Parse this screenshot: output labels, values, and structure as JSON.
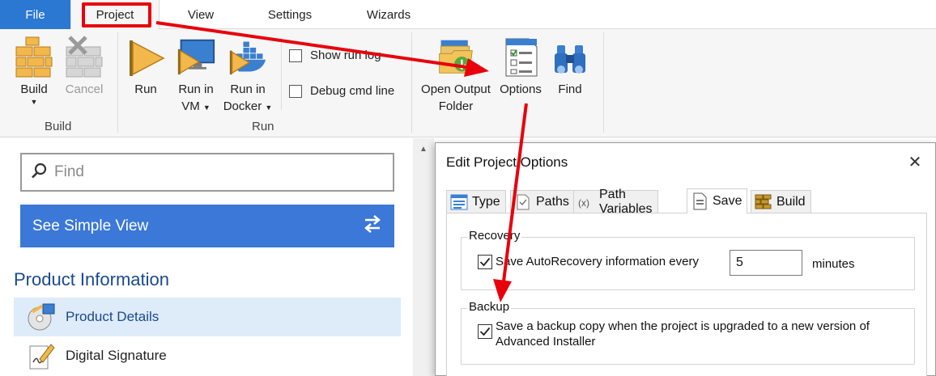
{
  "tabs": {
    "file": "File",
    "project": "Project",
    "view": "View",
    "settings": "Settings",
    "wizards": "Wizards"
  },
  "ribbon": {
    "build_group": {
      "label": "Build",
      "build": "Build",
      "cancel": "Cancel"
    },
    "run_group": {
      "label": "Run",
      "run": "Run",
      "run_in_vm_1": "Run in",
      "run_in_vm_2": "VM",
      "run_in_docker_1": "Run in",
      "run_in_docker_2": "Docker",
      "show_run_log": "Show run log",
      "debug_cmd_line": "Debug cmd line"
    },
    "tools_group": {
      "open_output_1": "Open Output",
      "open_output_2": "Folder",
      "options": "Options",
      "find": "Find"
    }
  },
  "left_panel": {
    "search_placeholder": "Find",
    "simple_view_button": "See Simple View",
    "section_title": "Product Information",
    "items": [
      {
        "label": "Product Details",
        "selected": true
      },
      {
        "label": "Digital Signature",
        "selected": false
      }
    ]
  },
  "dialog": {
    "title": "Edit Project Options",
    "tabs": [
      "Type",
      "Paths",
      "Path Variables",
      "Save",
      "Build"
    ],
    "active_tab": "Save",
    "recovery": {
      "title": "Recovery",
      "checkbox_label": "Save AutoRecovery information every",
      "checked": true,
      "minutes_value": "5",
      "minutes_label": "minutes"
    },
    "backup": {
      "title": "Backup",
      "checkbox_label_line1": "Save a backup copy when the project is upgraded to a new version of",
      "checkbox_label_line2": "Advanced Installer",
      "checked": true
    }
  },
  "colors": {
    "accent_blue": "#2b78d3",
    "simple_view_blue": "#3b78d8",
    "annotation_red": "#e8000b",
    "selected_row": "#deebf9"
  }
}
